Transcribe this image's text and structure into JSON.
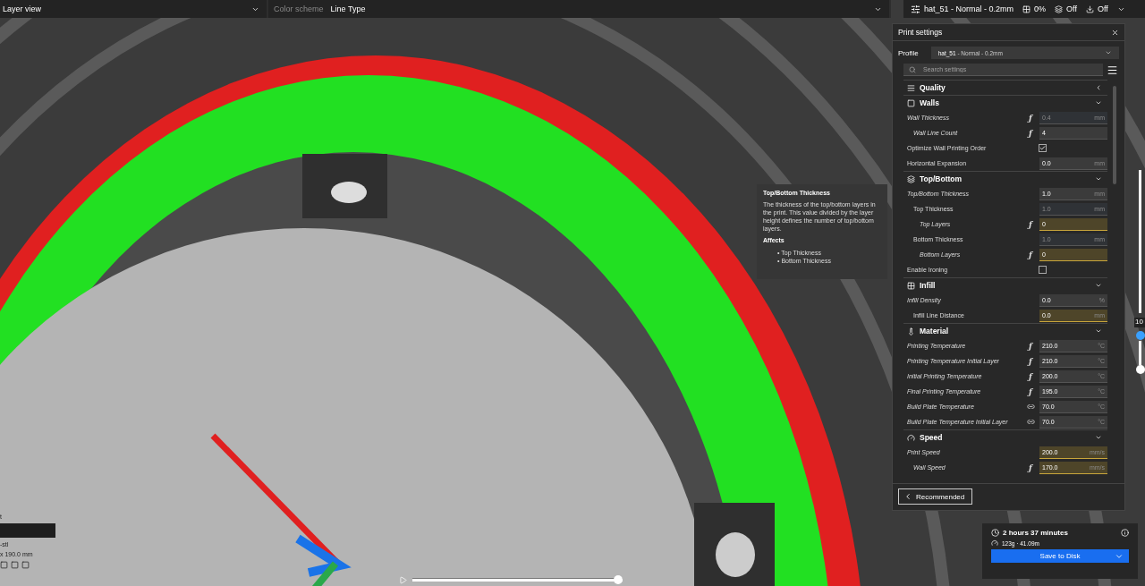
{
  "top_bar": {
    "view_mode": "Layer view",
    "color_scheme_label": "Color scheme",
    "color_scheme": "Line Type",
    "profile": "hat_51 - Normal - 0.2mm",
    "support": "0%",
    "adhesion": "Off",
    "export": "Off"
  },
  "print_settings": {
    "title": "Print settings",
    "profile_label": "Profile",
    "profile_name": "hat_51",
    "profile_detail": " - Normal - 0.2mm",
    "search_placeholder": "Search settings",
    "rows": [
      {
        "kind": "section",
        "label": "Quality",
        "expanded": false
      },
      {
        "kind": "section",
        "label": "Walls",
        "expanded": true
      },
      {
        "kind": "setting",
        "label": "Wall Thickness",
        "italic": true,
        "function_symbol": "ƒ",
        "value": "0.4",
        "unit": "mm",
        "disabled": true,
        "warning": false,
        "children": [
          {
            "kind": "setting",
            "label": "Wall Line Count",
            "italic": true,
            "function_symbol": "ƒ",
            "value": "4",
            "disabled": false,
            "warning": false
          }
        ]
      },
      {
        "kind": "checkbox",
        "label": "Optimize Wall Printing Order",
        "checked": true
      },
      {
        "kind": "setting",
        "label": "Horizontal Expansion",
        "italic": false,
        "value": "0.0",
        "unit": "mm",
        "disabled": false,
        "warning": false
      },
      {
        "kind": "section",
        "label": "Top/Bottom",
        "expanded": true
      },
      {
        "kind": "setting",
        "label": "Top/Bottom Thickness",
        "italic": true,
        "value": "1.0",
        "unit": "mm",
        "disabled": false,
        "warning": false,
        "children": [
          {
            "kind": "setting",
            "label": "Top Thickness",
            "italic": false,
            "value": "1.0",
            "unit": "mm",
            "disabled": true,
            "warning": false,
            "children": [
              {
                "kind": "setting",
                "label": "Top Layers",
                "italic": true,
                "function_symbol": "ƒ",
                "value": "0",
                "disabled": false,
                "warning": true
              }
            ]
          },
          {
            "kind": "setting",
            "label": "Bottom Thickness",
            "italic": false,
            "value": "1.0",
            "unit": "mm",
            "disabled": true,
            "warning": false,
            "children": [
              {
                "kind": "setting",
                "label": "Bottom Layers",
                "italic": true,
                "function_symbol": "ƒ",
                "value": "0",
                "disabled": false,
                "warning": true
              }
            ]
          }
        ]
      },
      {
        "kind": "checkbox",
        "label": "Enable Ironing",
        "checked": false
      },
      {
        "kind": "section",
        "label": "Infill",
        "expanded": true
      },
      {
        "kind": "setting",
        "label": "Infill Density",
        "italic": true,
        "value": "0.0",
        "unit": "%",
        "disabled": false,
        "warning": false,
        "children": [
          {
            "kind": "setting",
            "label": "Infill Line Distance",
            "italic": false,
            "value": "0.0",
            "unit": "mm",
            "disabled": false,
            "warning": true
          }
        ]
      },
      {
        "kind": "section",
        "label": "Material",
        "expanded": true
      },
      {
        "kind": "setting",
        "label": "Printing Temperature",
        "italic": true,
        "function_symbol": "ƒ",
        "value": "210.0",
        "unit": "°C",
        "disabled": false,
        "warning": false
      },
      {
        "kind": "setting",
        "label": "Printing Temperature Initial Layer",
        "italic": true,
        "function_symbol": "ƒ",
        "value": "210.0",
        "unit": "°C",
        "disabled": false,
        "warning": false
      },
      {
        "kind": "setting",
        "label": "Initial Printing Temperature",
        "italic": true,
        "function_symbol": "ƒ",
        "value": "200.0",
        "unit": "°C",
        "disabled": false,
        "warning": false
      },
      {
        "kind": "setting",
        "label": "Final Printing Temperature",
        "italic": true,
        "function_symbol": "ƒ",
        "value": "195.0",
        "unit": "°C",
        "disabled": false,
        "warning": false
      },
      {
        "kind": "setting",
        "label": "Build Plate Temperature",
        "italic": true,
        "linked": true,
        "value": "70.0",
        "unit": "°C",
        "disabled": false,
        "warning": false
      },
      {
        "kind": "setting",
        "label": "Build Plate Temperature Initial Layer",
        "italic": true,
        "linked": true,
        "value": "70.0",
        "unit": "°C",
        "disabled": false,
        "warning": false
      },
      {
        "kind": "section",
        "label": "Speed",
        "expanded": true
      },
      {
        "kind": "setting",
        "label": "Print Speed",
        "italic": true,
        "value": "200.0",
        "unit": "mm/s",
        "disabled": false,
        "warning": true,
        "children": [
          {
            "kind": "setting",
            "label": "Wall Speed",
            "italic": true,
            "function_symbol": "ƒ",
            "value": "170.0",
            "unit": "mm/s",
            "disabled": false,
            "warning": true
          }
        ]
      }
    ],
    "recommended_button": "Recommended"
  },
  "tooltip": {
    "title": "Top/Bottom Thickness",
    "description": "The thickness of the top/bottom layers in the print. This value divided by the layer height defines the number of top/bottom layers.",
    "affects_heading": "Affects",
    "bullet": "•",
    "affects": [
      "Top Thickness",
      "Bottom Thickness"
    ]
  },
  "layer_slider": {
    "label": "10"
  },
  "object_info": {
    "name_fragment": "t",
    "file_fragment": "-stl",
    "size_fragment": "x 190.0 mm"
  },
  "playback": {
    "level": 1.0
  },
  "job": {
    "time": "2 hours 37 minutes",
    "material": "123g · 41.09m",
    "save_button": "Save to Disk"
  }
}
